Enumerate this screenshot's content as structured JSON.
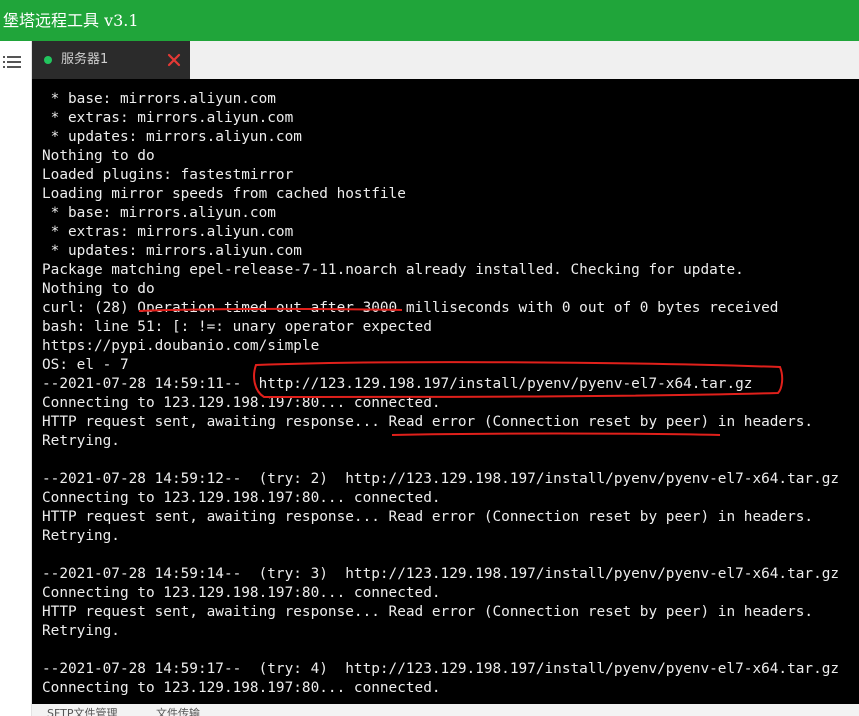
{
  "window": {
    "title": "堡塔远程工具 v3.1"
  },
  "tabs": [
    {
      "label": "服务器1",
      "status_color": "#22c55e"
    }
  ],
  "terminal": {
    "lines": [
      " * base: mirrors.aliyun.com",
      " * extras: mirrors.aliyun.com",
      " * updates: mirrors.aliyun.com",
      "Nothing to do",
      "Loaded plugins: fastestmirror",
      "Loading mirror speeds from cached hostfile",
      " * base: mirrors.aliyun.com",
      " * extras: mirrors.aliyun.com",
      " * updates: mirrors.aliyun.com",
      "Package matching epel-release-7-11.noarch already installed. Checking for update.",
      "Nothing to do",
      "curl: (28) Operation timed out after 3000 milliseconds with 0 out of 0 bytes received",
      "bash: line 51: [: !=: unary operator expected",
      "https://pypi.doubanio.com/simple",
      "OS: el - 7",
      "--2021-07-28 14:59:11--  http://123.129.198.197/install/pyenv/pyenv-el7-x64.tar.gz",
      "Connecting to 123.129.198.197:80... connected.",
      "HTTP request sent, awaiting response... Read error (Connection reset by peer) in headers.",
      "Retrying.",
      "",
      "--2021-07-28 14:59:12--  (try: 2)  http://123.129.198.197/install/pyenv/pyenv-el7-x64.tar.gz",
      "Connecting to 123.129.198.197:80... connected.",
      "HTTP request sent, awaiting response... Read error (Connection reset by peer) in headers.",
      "Retrying.",
      "",
      "--2021-07-28 14:59:14--  (try: 3)  http://123.129.198.197/install/pyenv/pyenv-el7-x64.tar.gz",
      "Connecting to 123.129.198.197:80... connected.",
      "HTTP request sent, awaiting response... Read error (Connection reset by peer) in headers.",
      "Retrying.",
      "",
      "--2021-07-28 14:59:17--  (try: 4)  http://123.129.198.197/install/pyenv/pyenv-el7-x64.tar.gz",
      "Connecting to 123.129.198.197:80... connected."
    ]
  },
  "bottom_tabs": [
    "SFTP文件管理",
    "文件传输"
  ],
  "colors": {
    "titlebar": "#20a53a",
    "terminal_bg": "#000000",
    "terminal_text": "#ededed",
    "annotation": "#e0201b",
    "close_icon": "#e53935"
  },
  "icons": {
    "menu": "menu-icon",
    "close": "close-icon",
    "status": "status-dot-icon"
  }
}
